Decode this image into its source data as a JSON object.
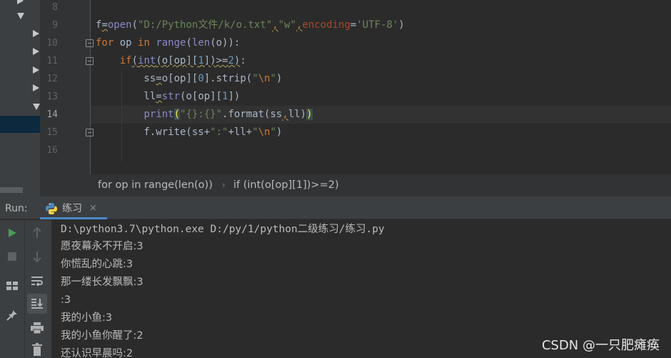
{
  "editor": {
    "lines": [
      {
        "number": "8",
        "code": ""
      },
      {
        "number": "9",
        "code": "f=open(\"D:/Python文件/k/o.txt\",\"w\",encoding='UTF-8')"
      },
      {
        "number": "10",
        "code": "for op in range(len(o)):"
      },
      {
        "number": "11",
        "code": "    if(int(o[op][1])>=2):"
      },
      {
        "number": "12",
        "code": "        ss=o[op][0].strip(\"\\n\")"
      },
      {
        "number": "13",
        "code": "        ll=str(o[op][1])"
      },
      {
        "number": "14",
        "code": "        print(\"{}:{}\".format(ss,ll))"
      },
      {
        "number": "15",
        "code": "        f.write(ss+\":\"+ll+\"\\n\")"
      },
      {
        "number": "16",
        "code": ""
      }
    ],
    "current_line": "14"
  },
  "breadcrumb": {
    "items": [
      "for op in range(len(o))",
      "if (int(o[op][1])>=2)"
    ],
    "separator": "›"
  },
  "run_panel": {
    "label": "Run:",
    "tab_label": "练习",
    "tab_close": "×",
    "toolbar_icons": [
      "rerun-icon",
      "stop-icon",
      "layout-icon",
      "pin-icon",
      "scroll-up-icon",
      "scroll-down-icon",
      "soft-wrap-icon",
      "scroll-to-end-icon",
      "print-icon",
      "trash-icon"
    ],
    "console_lines": [
      "D:\\python3.7\\python.exe D:/py/1/python二级练习/练习.py",
      "愿夜幕永不开启:3",
      "你慌乱的心跳:3",
      "那一缕长发飘飘:3",
      ":3",
      "我的小鱼:3",
      "我的小鱼你醒了:2",
      "还认识早晨吗:2"
    ]
  },
  "watermark": "CSDN @一只肥瘫痪",
  "colors": {
    "background": "#2b2b2b",
    "keyword": "#cc7832",
    "string": "#6a8759",
    "builtin": "#8888c6",
    "number": "#6897bb",
    "run_green": "#499c54",
    "tab_underline": "#4a88c7"
  }
}
